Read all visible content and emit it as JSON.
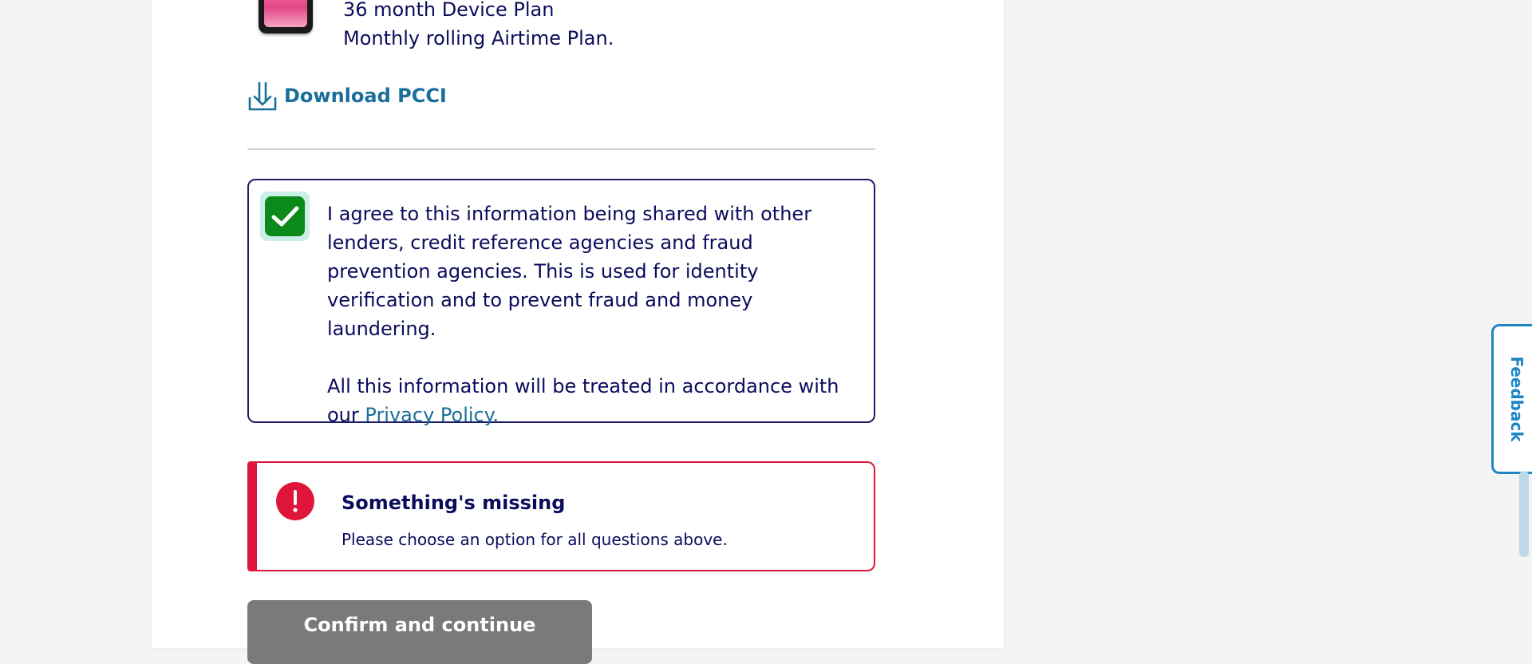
{
  "plan": {
    "device_plan": "36 month Device Plan",
    "airtime_plan": "Monthly rolling Airtime Plan."
  },
  "download": {
    "label": "Download PCCI",
    "icon": "download-icon"
  },
  "consent": {
    "checked": true,
    "paragraph1": "I agree to this information being shared with other lenders, credit reference agencies and fraud prevention agencies. This is used for identity verification and to prevent fraud and money laundering.",
    "paragraph2_prefix": "All this information will be treated in accordance with our ",
    "privacy_link": "Privacy Policy."
  },
  "error": {
    "icon": "exclamation-icon",
    "title": "Something's missing",
    "message": "Please choose an option for all questions above."
  },
  "confirm_button": {
    "label": "Confirm and continue"
  },
  "feedback": {
    "label": "Feedback"
  },
  "colors": {
    "navy_text": "#0b0b5c",
    "link_blue": "#1a6e9a",
    "check_green": "#0b8a1a",
    "error_red": "#e0153a",
    "disabled_button": "#7a7a7a"
  }
}
